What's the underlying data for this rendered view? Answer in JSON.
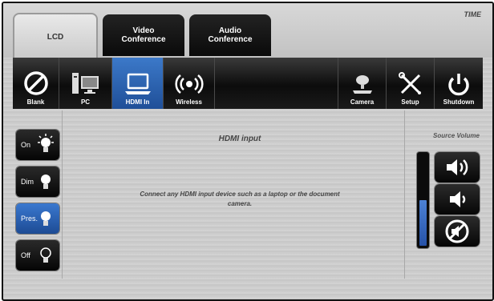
{
  "tabs": [
    {
      "label": "LCD",
      "active": true
    },
    {
      "label": "Video\nConference",
      "active": false
    },
    {
      "label": "Audio\nConference",
      "active": false
    }
  ],
  "time_label": "TIME",
  "toolbar": {
    "blank": "Blank",
    "pc": "PC",
    "hdmi_in": "HDMI In",
    "wireless": "Wireless",
    "camera": "Camera",
    "setup": "Setup",
    "shutdown": "Shutdown"
  },
  "lights": [
    {
      "label": "On",
      "active": false
    },
    {
      "label": "Dim",
      "active": false
    },
    {
      "label": "Pres.",
      "active": true
    },
    {
      "label": "Off",
      "active": false
    }
  ],
  "main": {
    "title": "HDMI input",
    "message": "Connect any HDMI input device such as a laptop or the document camera."
  },
  "source_volume": {
    "label": "Source Volume",
    "level_fraction": 0.5
  },
  "colors": {
    "accent": "#2f63b5",
    "dark": "#0a0a0a"
  }
}
